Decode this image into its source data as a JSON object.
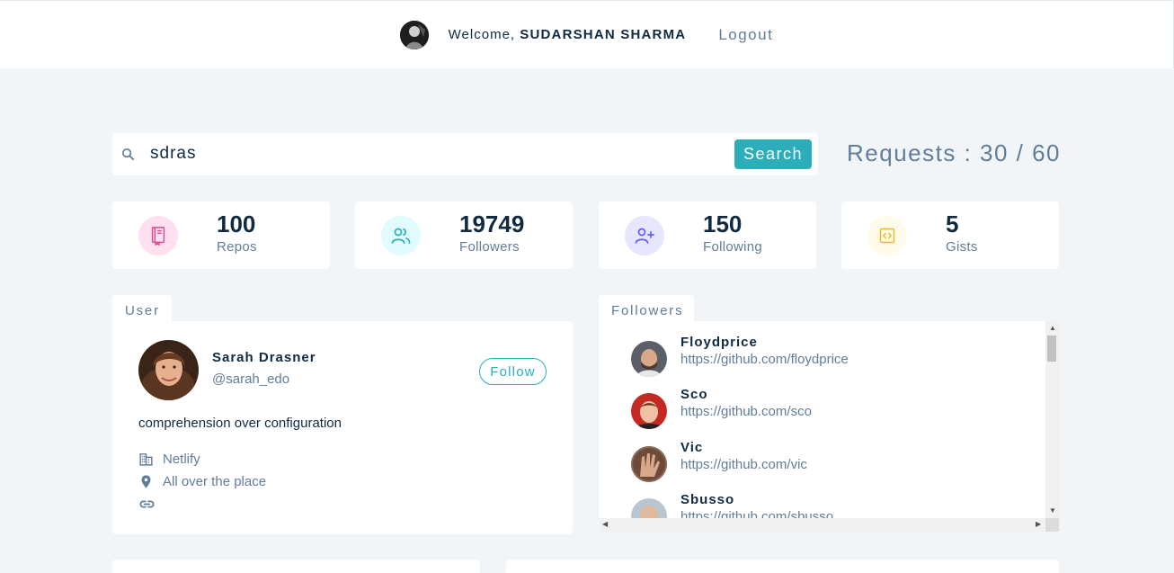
{
  "nav": {
    "welcome_prefix": "Welcome,",
    "user_name": "SUDARSHAN SHARMA",
    "logout_label": "Logout"
  },
  "search": {
    "value": "sdras",
    "button_label": "Search",
    "requests_text": "Requests : 30 / 60"
  },
  "stats": [
    {
      "value": "100",
      "label": "Repos",
      "icon": "book-icon",
      "color": "#da4a91",
      "bg": "#ffe0f0"
    },
    {
      "value": "19749",
      "label": "Followers",
      "icon": "users-icon",
      "color": "#2caeba",
      "bg": "#e0fcff"
    },
    {
      "value": "150",
      "label": "Following",
      "icon": "user-plus-icon",
      "color": "#645cff",
      "bg": "#e6e6ff"
    },
    {
      "value": "5",
      "label": "Gists",
      "icon": "code-icon",
      "color": "#f0b429",
      "bg": "#fffbea"
    }
  ],
  "user_section": {
    "tab_label": "User",
    "name": "Sarah Drasner",
    "handle": "@sarah_edo",
    "follow_label": "Follow",
    "bio": "comprehension over configuration",
    "company": "Netlify",
    "location": "All over the place",
    "blog": ""
  },
  "followers_section": {
    "tab_label": "Followers",
    "items": [
      {
        "name": "Floydprice",
        "url": "https://github.com/floydprice"
      },
      {
        "name": "Sco",
        "url": "https://github.com/sco"
      },
      {
        "name": "Vic",
        "url": "https://github.com/vic"
      },
      {
        "name": "Sbusso",
        "url": "https://github.com/sbusso"
      }
    ]
  },
  "colors": {
    "primary": "#2caeba",
    "text_dark": "#102a42",
    "text_muted": "#617d98",
    "background": "#f1f5f8"
  }
}
